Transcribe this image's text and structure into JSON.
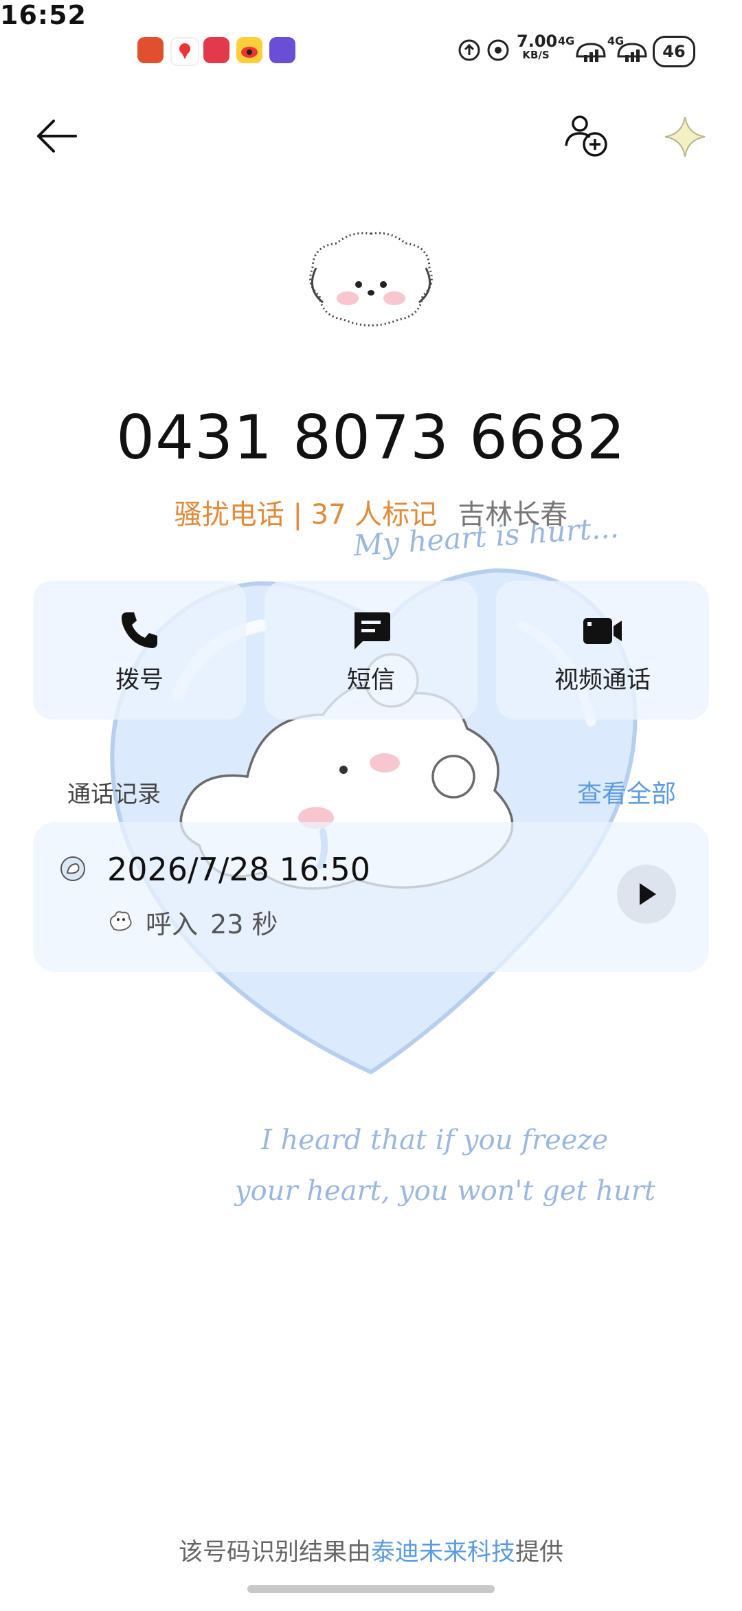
{
  "status_bar": {
    "time": "16:52",
    "net_speed_value": "7.00",
    "net_speed_unit": "KB/S",
    "sim1": "4G",
    "sim2": "4G",
    "battery": "46"
  },
  "contact": {
    "number": "0431 8073 6682",
    "tag": "骚扰电话 | 37 人标记",
    "location": "吉林长春"
  },
  "actions": [
    {
      "label": "拨号",
      "icon": "phone-icon"
    },
    {
      "label": "短信",
      "icon": "message-icon"
    },
    {
      "label": "视频通话",
      "icon": "video-icon"
    }
  ],
  "records": {
    "title": "通话记录",
    "view_all": "查看全部",
    "items": [
      {
        "datetime": "2026/7/28 16:50",
        "direction": "呼入",
        "duration": "23 秒"
      }
    ]
  },
  "wallpaper_text": {
    "line1": "My heart is hurt...",
    "line2": "I heard that if you freeze",
    "line3": "your heart, you won't get hurt"
  },
  "footer": {
    "prefix": "该号码识别结果由",
    "provider": "泰迪未来科技",
    "suffix": "提供"
  },
  "colors": {
    "spam_tag": "#e08a3a",
    "link": "#5b9be0",
    "card_bg": "#ecf4ff"
  }
}
